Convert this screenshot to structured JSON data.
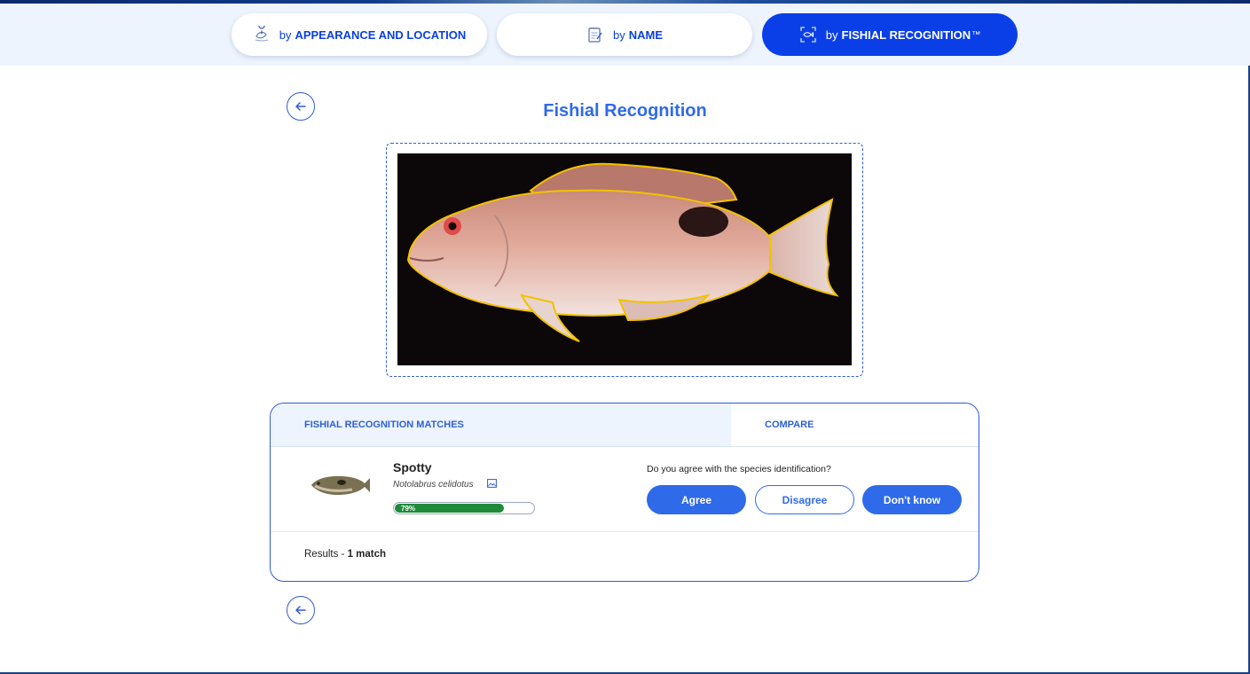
{
  "nav_tabs": [
    {
      "prefix": "by",
      "label": "APPEARANCE AND LOCATION",
      "icon": "fish-location-icon",
      "active": false
    },
    {
      "prefix": "by",
      "label": "NAME",
      "icon": "notepad-icon",
      "active": false
    },
    {
      "prefix": "by",
      "label": "FISHIAL RECOGNITION",
      "suffix": "™",
      "icon": "fish-scan-icon",
      "active": true
    }
  ],
  "page": {
    "title": "Fishial Recognition",
    "back_icon": "arrow-left-icon"
  },
  "panel": {
    "tab_matches": "FISHIAL RECOGNITION MATCHES",
    "tab_compare": "COMPARE",
    "active_tab": "matches",
    "match": {
      "common_name": "Spotty",
      "latin_name": "Notolabrus celidotus",
      "confidence_label": "79%",
      "confidence": 0.79,
      "image_icon": "image-icon"
    },
    "question": "Do you agree with the species identification?",
    "buttons": {
      "agree": "Agree",
      "disagree": "Disagree",
      "dont_know": "Don't know"
    },
    "results_prefix": "Results - ",
    "results_count": "1 match"
  },
  "colors": {
    "primary": "#2f6ae8",
    "active_tab": "#0a3fe8",
    "confidence_bar": "#1f8a3a",
    "highlight_bg": "#eef4fd"
  }
}
